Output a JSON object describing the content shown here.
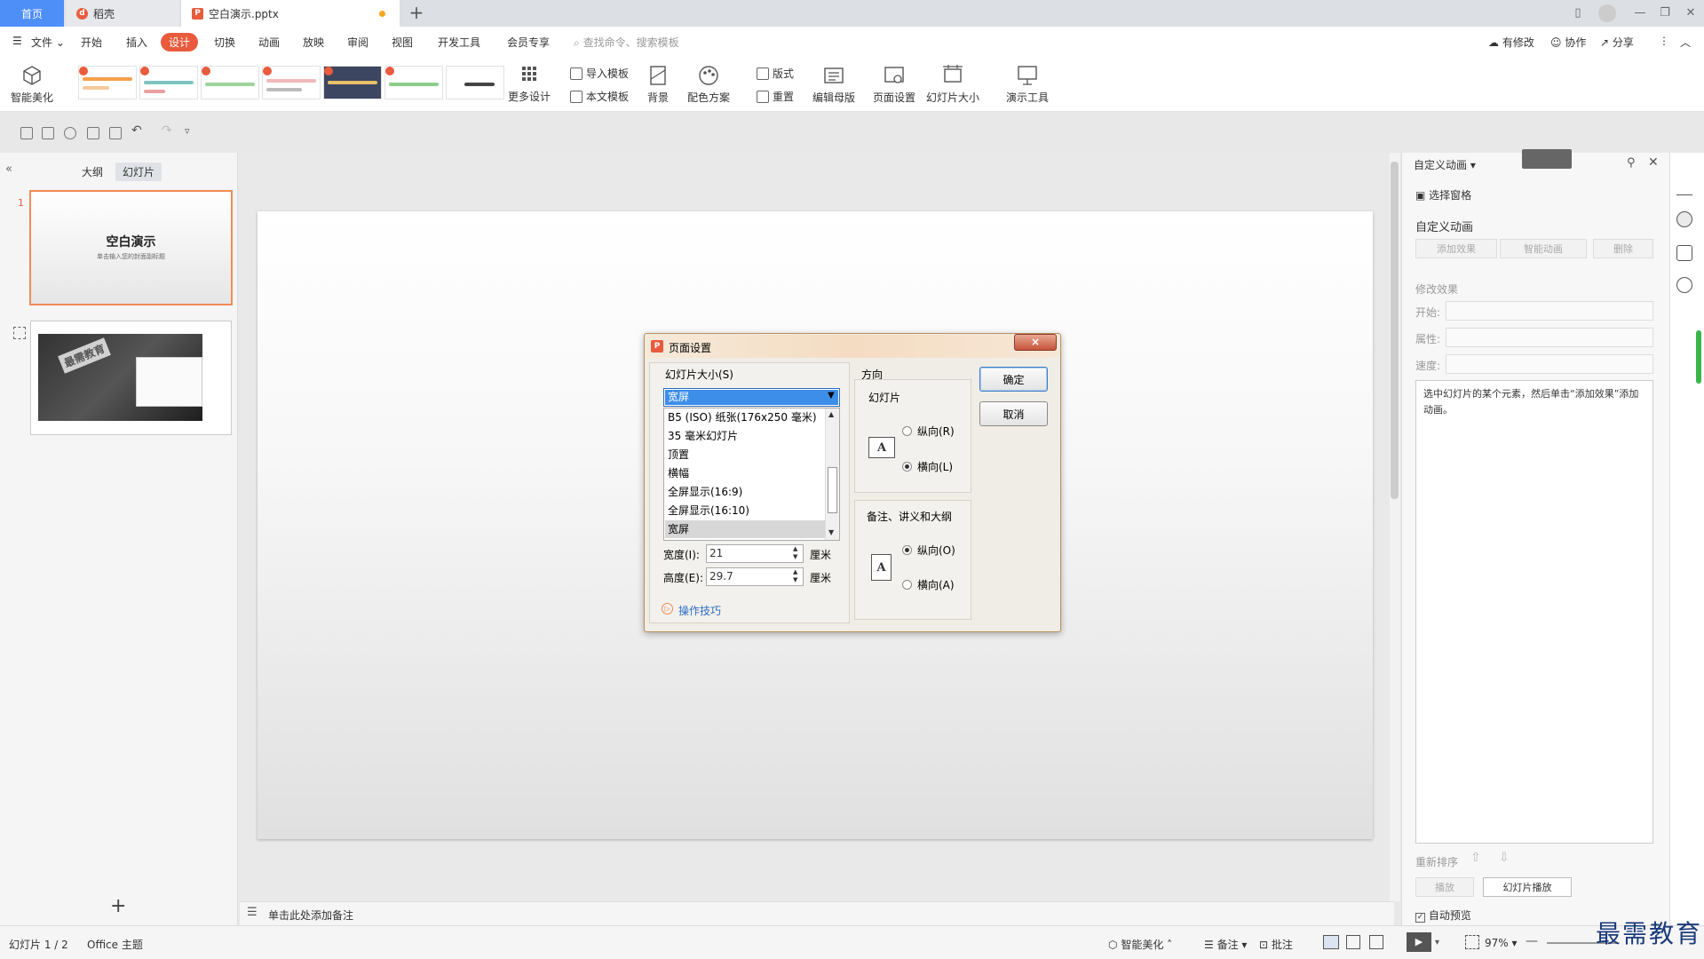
{
  "titlebar": {
    "tab_home": "首页",
    "tab_daoke": "稻壳",
    "tab_doc": "空白演示.pptx",
    "new_tab": "+"
  },
  "menubar": {
    "file": "文件",
    "items": [
      "开始",
      "插入",
      "设计",
      "切换",
      "动画",
      "放映",
      "审阅",
      "视图",
      "开发工具",
      "会员专享"
    ],
    "active": "设计",
    "search_placeholder": "查找命令、搜索模板",
    "right": [
      "有修改",
      "协作",
      "分享"
    ]
  },
  "ribbon": {
    "smart_beautify": "智能美化",
    "more_design": "更多设计",
    "import_template": "导入模板",
    "this_template": "本文模板",
    "background": "背景",
    "color_scheme": "配色方案",
    "layout": "版式",
    "reset": "重置",
    "edit_master": "编辑母版",
    "page_setup": "页面设置",
    "slide_size": "幻灯片大小",
    "present_tools": "演示工具",
    "theme_thumbs": [
      "theme-1",
      "theme-2",
      "theme-3",
      "theme-4",
      "theme-5",
      "theme-6"
    ]
  },
  "leftpanel": {
    "tab_outline": "大纲",
    "tab_slides": "幻灯片",
    "slide1_number": "1",
    "slide1_title": "空白演示",
    "slide1_sub": "单击输入您的封面副标题",
    "slide2_watermark": "最需教育",
    "add": "+"
  },
  "notes": {
    "placeholder": "单击此处添加备注"
  },
  "dialog": {
    "title": "页面设置",
    "close": "×",
    "size_label": "幻灯片大小(S)",
    "combo_value": "宽屏",
    "list_items": [
      "B5 (ISO) 纸张(176x250 毫米)",
      "35 毫米幻灯片",
      "顶置",
      "横幅",
      "全屏显示(16:9)",
      "全屏显示(16:10)",
      "宽屏"
    ],
    "selected_item": "宽屏",
    "width_label": "宽度(I):",
    "width_value": "21",
    "height_label": "高度(E):",
    "height_value": "29.7",
    "unit": "厘米",
    "tips": "操作技巧",
    "orientation": "方向",
    "slides_group": "幻灯片",
    "portrait": "纵向(R)",
    "landscape": "横向(L)",
    "slides_orientation": "landscape",
    "notes_group": "备注、讲义和大纲",
    "notes_portrait": "纵向(O)",
    "notes_landscape": "横向(A)",
    "notes_orientation": "portrait",
    "ok": "确定",
    "cancel": "取消",
    "page_icon_letter": "A"
  },
  "rightpanel": {
    "header": "自定义动画",
    "select_pane": "选择窗格",
    "section": "自定义动画",
    "add_effect": "添加效果",
    "smart_anim": "智能动画",
    "delete": "删除",
    "modify": "修改效果",
    "start": "开始:",
    "property": "属性:",
    "speed": "速度:",
    "desc": "选中幻灯片的某个元素，然后单击“添加效果”添加动画。",
    "reorder": "重新排序",
    "play": "播放",
    "slide_play": "幻灯片播放",
    "auto_preview": "自动预览",
    "auto_preview_checked": true
  },
  "statusbar": {
    "slide_info": "幻灯片 1 / 2",
    "theme": "Office 主题",
    "smart_beautify": "智能美化",
    "notes": "备注",
    "comments": "批注",
    "zoom": "97%"
  },
  "watermark": "最需教育",
  "colors": {
    "accent": "#e95b3d",
    "home_tab": "#4e8ef7",
    "selection": "#3d8ee9"
  }
}
